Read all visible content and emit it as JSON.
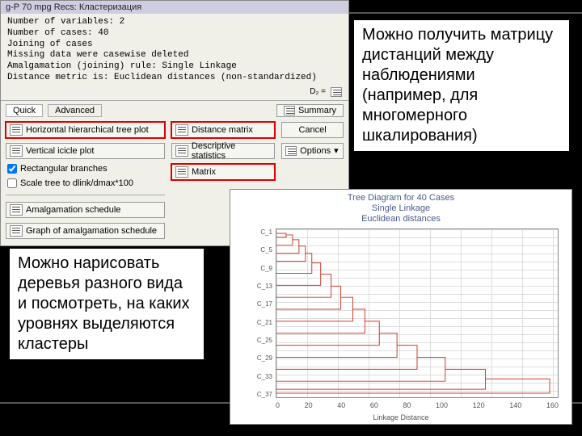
{
  "callouts": {
    "right": "Можно получить матрицу дистанций между наблюдениями (например, для многомерного шкалирования)",
    "left": "Можно нарисовать деревья разного вида и посмотреть, на каких уровнях выделяются кластеры"
  },
  "dialog": {
    "title": "g-P 70 mpg Recs: Кластеризация",
    "info_lines": [
      "Number of variables: 2",
      "Number of cases: 40",
      "Joining of cases",
      "Missing data were casewise deleted",
      "Amalgamation (joining) rule: Single Linkage",
      "Distance metric is: Euclidean distances (non-standardized)"
    ],
    "d_label": "D₂ =",
    "tabs": {
      "quick": "Quick",
      "advanced": "Advanced"
    },
    "summary_btn": "Summary",
    "cancel_btn": "Cancel",
    "options_btn": "Options",
    "buttons": {
      "htree": "Horizontal hierarchical tree plot",
      "vtree": "Vertical icicle plot",
      "dmatrix": "Distance matrix",
      "descr": "Descriptive statistics",
      "matrix": "Matrix",
      "amalg": "Amalgamation schedule",
      "graph": "Graph of amalgamation schedule"
    },
    "checks": {
      "rect": "Rectangular branches",
      "scale": "Scale tree to dlink/dmax*100"
    }
  },
  "dendro": {
    "title1": "Tree Diagram for 40 Cases",
    "title2": "Single Linkage",
    "title3": "Euclidean distances",
    "x_ticks": [
      "0",
      "20",
      "40",
      "60",
      "80",
      "100",
      "120",
      "140",
      "160"
    ],
    "xlabel": "Linkage Distance",
    "y_sample": [
      "C_1",
      "C_5",
      "C_9",
      "C_13",
      "C_17",
      "C_21",
      "C_25",
      "C_29",
      "C_33",
      "C_37"
    ]
  }
}
